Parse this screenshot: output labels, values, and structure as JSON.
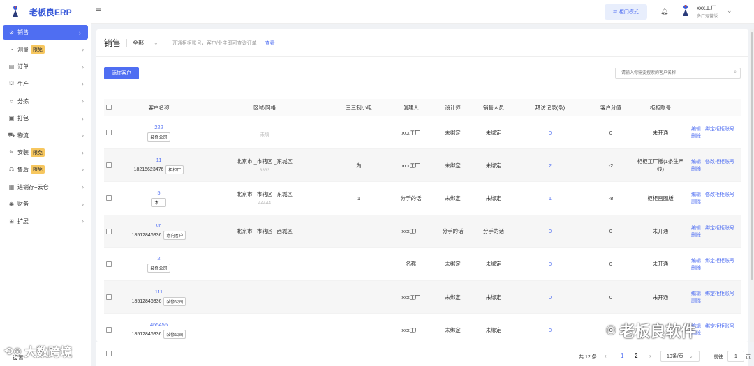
{
  "app": {
    "logo_text": "老板良ERP"
  },
  "sidebar": {
    "items": [
      {
        "label": "销售",
        "icon": "tag-icon",
        "badge": ""
      },
      {
        "label": "测量",
        "icon": "gauge-icon",
        "badge": "限免"
      },
      {
        "label": "订单",
        "icon": "document-icon",
        "badge": ""
      },
      {
        "label": "生产",
        "icon": "factory-icon",
        "badge": ""
      },
      {
        "label": "分拣",
        "icon": "circle-icon",
        "badge": ""
      },
      {
        "label": "打包",
        "icon": "box-icon",
        "badge": ""
      },
      {
        "label": "物流",
        "icon": "truck-icon",
        "badge": ""
      },
      {
        "label": "安装",
        "icon": "wrench-icon",
        "badge": "限免"
      },
      {
        "label": "售后",
        "icon": "headset-icon",
        "badge": "限免"
      },
      {
        "label": "进销存+云仓",
        "icon": "grid-icon",
        "badge": ""
      },
      {
        "label": "财务",
        "icon": "coin-icon",
        "badge": ""
      },
      {
        "label": "扩展",
        "icon": "expand-icon",
        "badge": ""
      }
    ],
    "settings_label": "设置"
  },
  "header": {
    "mode_button": "柜门模式",
    "user_name": "xxx工厂",
    "user_role": "多厂运营版"
  },
  "main": {
    "title": "销售",
    "filter_value": "全部",
    "hint": "开通柜柜账号，客户/业主即可查询订单",
    "hint_link": "查看",
    "add_button": "添加客户",
    "search_placeholder": "请输入你需要搜索的客户名称"
  },
  "table": {
    "headers": {
      "name": "客户名称",
      "area": "区域/网格",
      "group": "三三制小组",
      "creator": "创建人",
      "designer": "设计师",
      "sales": "销售人员",
      "visits": "拜访记录(条)",
      "score": "客户分值",
      "account": "柜柜账号"
    },
    "rows": [
      {
        "name": "222",
        "phone": "",
        "tag": "装修公司",
        "area": "",
        "area_sub": "未填",
        "group": "",
        "creator": "xxx工厂",
        "designer": "未绑定",
        "sales": "未绑定",
        "visits": "0",
        "score": "0",
        "account": "未开通",
        "ops": [
          "编辑",
          "绑定柜柜账号",
          "删除"
        ]
      },
      {
        "name": "11",
        "phone": "18215623476",
        "tag": "柜柜厂",
        "area": "北京市 _市辖区 _东城区",
        "area_sub": "3333",
        "group": "为",
        "creator": "xxx工厂",
        "designer": "未绑定",
        "sales": "未绑定",
        "visits": "2",
        "score": "-2",
        "account": "柜柜工厂版(1条生产线)",
        "ops": [
          "编辑",
          "修改柜柜账号",
          "删除"
        ]
      },
      {
        "name": "5",
        "phone": "",
        "tag": "木工",
        "area": "北京市 _市辖区 _东城区",
        "area_sub": "44444",
        "group": "1",
        "creator": "分手的话",
        "designer": "未绑定",
        "sales": "未绑定",
        "visits": "1",
        "score": "-8",
        "account": "柜柜画图版",
        "ops": [
          "编辑",
          "修改柜柜账号",
          "删除"
        ]
      },
      {
        "name": "vc",
        "phone": "18512846336",
        "tag": "意向客户",
        "area": "北京市 _市辖区 _西城区",
        "area_sub": "",
        "group": "",
        "creator": "xxx工厂",
        "designer": "分手的话",
        "sales": "分手的话",
        "visits": "0",
        "score": "0",
        "account": "未开通",
        "ops": [
          "编辑",
          "绑定柜柜账号",
          "删除"
        ]
      },
      {
        "name": "2",
        "phone": "",
        "tag": "装修公司",
        "area": "",
        "area_sub": "",
        "group": "",
        "creator": "名称",
        "designer": "未绑定",
        "sales": "未绑定",
        "visits": "0",
        "score": "0",
        "account": "未开通",
        "ops": [
          "编辑",
          "绑定柜柜账号",
          "删除"
        ]
      },
      {
        "name": "111",
        "phone": "18512846336",
        "tag": "装修公司",
        "area": "",
        "area_sub": "",
        "group": "",
        "creator": "xxx工厂",
        "designer": "未绑定",
        "sales": "未绑定",
        "visits": "0",
        "score": "0",
        "account": "未开通",
        "ops": [
          "编辑",
          "绑定柜柜账号",
          "删除"
        ]
      },
      {
        "name": "465456",
        "phone": "18512846336",
        "tag": "装修公司",
        "area": "",
        "area_sub": "",
        "group": "",
        "creator": "xxx工厂",
        "designer": "未绑定",
        "sales": "未绑定",
        "visits": "0",
        "score": "0",
        "account": "",
        "ops": [
          "编辑",
          "绑定柜柜账号",
          "删除"
        ]
      }
    ]
  },
  "pagination": {
    "total": "共 12 条",
    "pages": [
      "1",
      "2"
    ],
    "page_size": "10条/页",
    "goto_label": "前往",
    "goto_value": "1",
    "page_suffix": "页"
  },
  "watermarks": {
    "left": "大数跨境",
    "right": "老板良软件"
  },
  "colors": {
    "accent": "#4f6ef2",
    "badge": "#f7c75f"
  }
}
